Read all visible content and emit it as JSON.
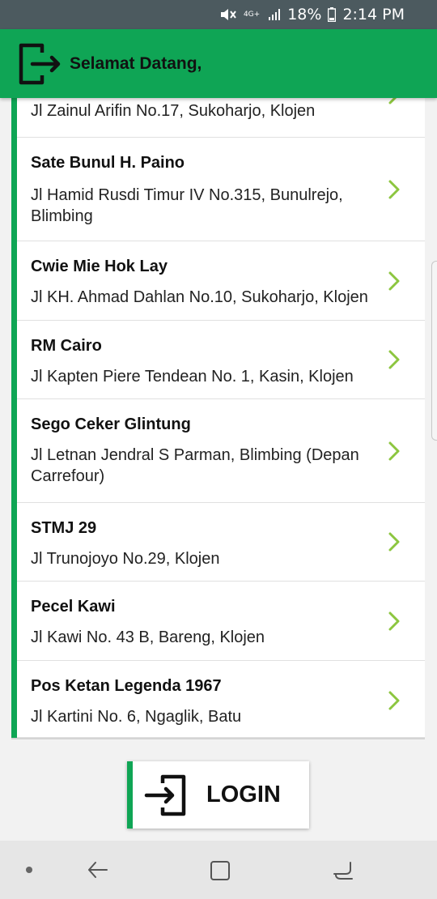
{
  "status_bar": {
    "network": "4G+",
    "battery": "18%",
    "time": "2:14 PM"
  },
  "header": {
    "title": "Selamat Datang,",
    "icon": "logout-icon"
  },
  "restaurants": [
    {
      "name": "",
      "address": "Jl Zainul Arifin No.17, Sukoharjo, Klojen"
    },
    {
      "name": "Sate Bunul H. Paino",
      "address": "Jl Hamid Rusdi Timur IV No.315, Bunulrejo, Blimbing"
    },
    {
      "name": "Cwie Mie Hok Lay",
      "address": "Jl KH. Ahmad Dahlan No.10, Sukoharjo, Klojen"
    },
    {
      "name": "RM Cairo",
      "address": "Jl Kapten Piere Tendean No. 1, Kasin, Klojen"
    },
    {
      "name": "Sego Ceker Glintung",
      "address": "Jl Letnan Jendral S Parman, Blimbing (Depan Carrefour)"
    },
    {
      "name": "STMJ 29",
      "address": "Jl Trunojoyo No.29, Klojen"
    },
    {
      "name": "Pecel Kawi",
      "address": "Jl Kawi No. 43 B, Bareng, Klojen"
    },
    {
      "name": "Pos Ketan Legenda 1967",
      "address": "Jl Kartini No. 6, Ngaglik, Batu"
    }
  ],
  "login_button": {
    "label": "LOGIN",
    "icon": "login-icon"
  },
  "colors": {
    "accent": "#0fa555",
    "chevron": "#8cc63f",
    "status_bar": "#4c5a5f"
  }
}
